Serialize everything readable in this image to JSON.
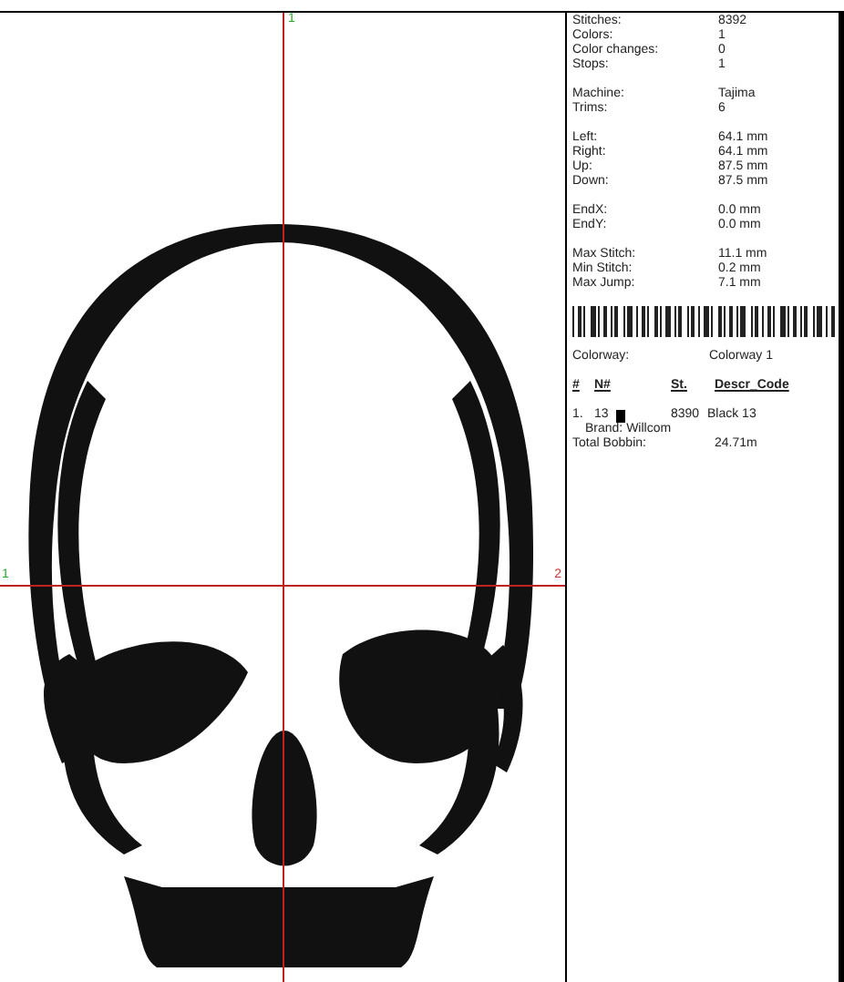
{
  "design": {
    "markers": [
      {
        "label": "1",
        "color": "#22aa22",
        "kind": "vertical"
      },
      {
        "label": "1",
        "color": "#22aa22",
        "kind": "start"
      },
      {
        "label": "2",
        "color": "#cc3333",
        "kind": "end"
      }
    ]
  },
  "stats": [
    [
      {
        "label": "Stitches:",
        "value": "8392"
      },
      {
        "label": "Colors:",
        "value": "1"
      },
      {
        "label": "Color changes:",
        "value": "0"
      },
      {
        "label": "Stops:",
        "value": "1"
      }
    ],
    [
      {
        "label": "Machine:",
        "value": "Tajima"
      },
      {
        "label": "Trims:",
        "value": "6"
      }
    ],
    [
      {
        "label": "Left:",
        "value": "64.1 mm"
      },
      {
        "label": "Right:",
        "value": "64.1 mm"
      },
      {
        "label": "Up:",
        "value": "87.5 mm"
      },
      {
        "label": "Down:",
        "value": "87.5 mm"
      }
    ],
    [
      {
        "label": "EndX:",
        "value": "0.0 mm"
      },
      {
        "label": "EndY:",
        "value": "0.0 mm"
      }
    ],
    [
      {
        "label": "Max Stitch:",
        "value": "11.1 mm"
      },
      {
        "label": "Min Stitch:",
        "value": "0.2 mm"
      },
      {
        "label": "Max Jump:",
        "value": "7.1 mm"
      }
    ]
  ],
  "colorway": {
    "label": "Colorway:",
    "value": "Colorway 1"
  },
  "columns": [
    "#",
    "N#",
    "St.",
    "Descr_Code"
  ],
  "threads": [
    {
      "index": "1.",
      "number": "13",
      "color": "#000000",
      "stitches": "8390",
      "code": "Black 13",
      "brand": "Brand: Willcom"
    }
  ],
  "total": {
    "label": "Total Bobbin:",
    "value": "24.71m"
  }
}
